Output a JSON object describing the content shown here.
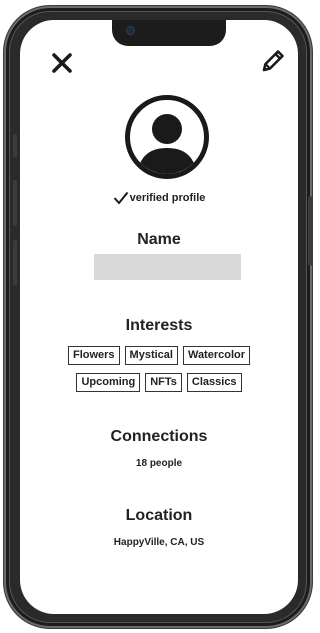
{
  "header": {
    "close_icon": "close-icon",
    "edit_icon": "pencil-icon"
  },
  "profile": {
    "avatar_icon": "user-avatar-icon",
    "verified_label": "verified profile",
    "name_title": "Name",
    "name_value": ""
  },
  "interests": {
    "title": "Interests",
    "row1": [
      "Flowers",
      "Mystical",
      "Watercolor"
    ],
    "row2": [
      "Upcoming",
      "NFTs",
      "Classics"
    ]
  },
  "connections": {
    "title": "Connections",
    "count_text": "18 people"
  },
  "location": {
    "title": "Location",
    "value": "HappyVille, CA, US"
  },
  "colors": {
    "frame": "#1c1c1c",
    "name_placeholder": "#d9d9d9",
    "text": "#222222"
  }
}
